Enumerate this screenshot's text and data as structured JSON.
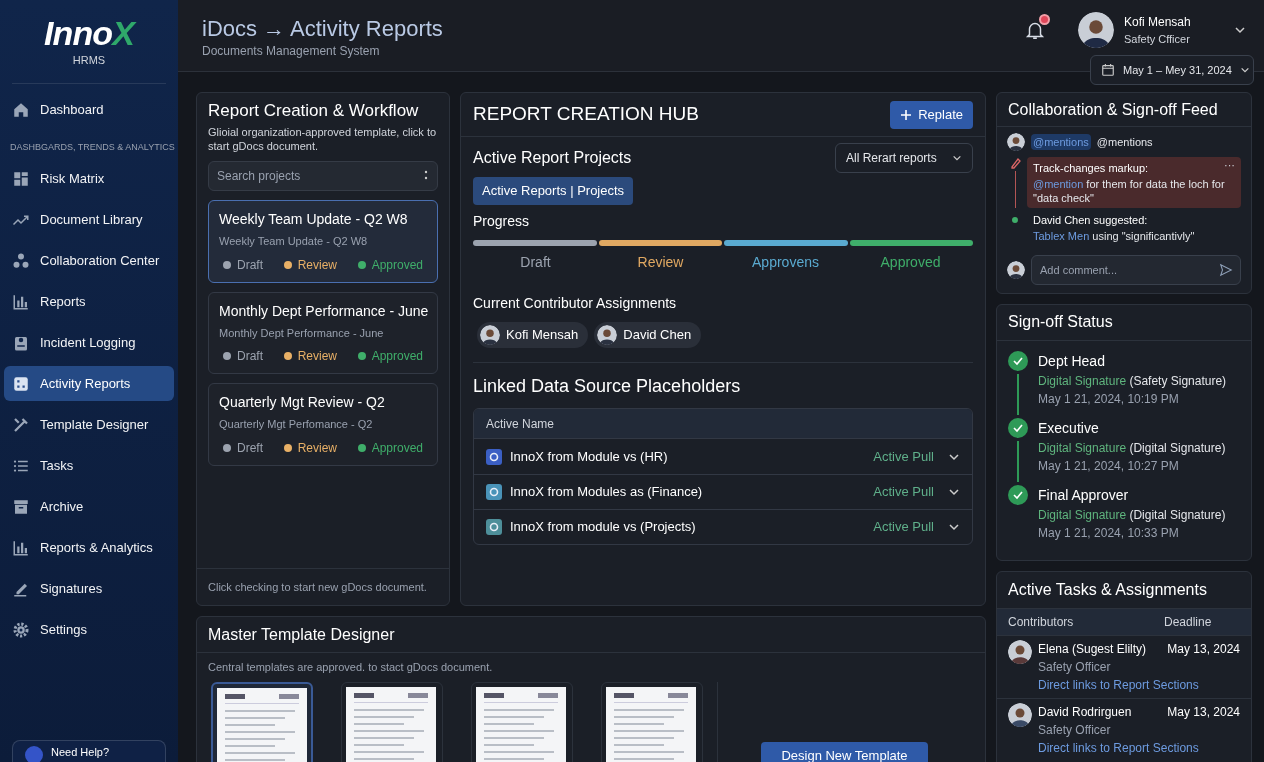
{
  "sidebar": {
    "logo": {
      "text": "Inno",
      "accent": "X",
      "subtitle": "HRMS"
    },
    "items": [
      {
        "kind": "item",
        "label": "Dashboard",
        "selected": false
      },
      {
        "kind": "section",
        "label": "DASHBGARDS, TRENDS & ANALYTICS"
      },
      {
        "kind": "item",
        "label": "Risk Matrix",
        "selected": false
      },
      {
        "kind": "item",
        "label": "Document Library",
        "selected": false
      },
      {
        "kind": "item",
        "label": "Collaboration Center",
        "selected": false
      },
      {
        "kind": "item",
        "label": "Reports",
        "selected": false
      },
      {
        "kind": "item",
        "label": "Incident Logging",
        "selected": false
      },
      {
        "kind": "item",
        "label": "Activity Reports",
        "selected": true
      },
      {
        "kind": "item",
        "label": "Template Designer",
        "selected": false
      },
      {
        "kind": "item",
        "label": "Tasks",
        "selected": false
      },
      {
        "kind": "item",
        "label": "Archive",
        "selected": false
      },
      {
        "kind": "item",
        "label": "Reports & Analytics",
        "selected": false
      },
      {
        "kind": "item",
        "label": "Signatures",
        "selected": false
      },
      {
        "kind": "item",
        "label": "Settings",
        "selected": false
      }
    ],
    "help": "Need Help?"
  },
  "header": {
    "title": "iDocs → Activity Reports",
    "subtitle": "Documents Management System",
    "notifications": true,
    "user": {
      "name": "Kofi Mensah",
      "role": "Safety Cfficer"
    },
    "date_range": "May 1 – Mey 31, 2024"
  },
  "workflow": {
    "title": "Report Creation & Workflow",
    "description": "Glioial organization-approved template, click to start gDocs document.",
    "search": {
      "placeholder": "Search projects"
    },
    "projects": [
      {
        "title": "Weekly Team Update - Q2 W8",
        "subtitle": "Weekly Team Update - Q2 W8",
        "selected": true,
        "statuses": [
          {
            "label": "Draft",
            "color": "#9ca3af"
          },
          {
            "label": "Review",
            "color": "#e8b066"
          },
          {
            "label": "Approved",
            "color": "#3fae6a"
          }
        ]
      },
      {
        "title": "Monthly Dept Performance - June",
        "subtitle": "Monthly Dept Performance - June",
        "selected": false,
        "statuses": [
          {
            "label": "Draft",
            "color": "#9ca3af"
          },
          {
            "label": "Review",
            "color": "#e8b066"
          },
          {
            "label": "Approved",
            "color": "#3fae6a"
          }
        ]
      },
      {
        "title": "Quarterly Mgt Review - Q2",
        "subtitle": "Quarterly Mgt Perfomance - Q2",
        "selected": false,
        "statuses": [
          {
            "label": "Dreft",
            "color": "#9ca3af"
          },
          {
            "label": "Review",
            "color": "#e8b066"
          },
          {
            "label": "Approved",
            "color": "#3fae6a"
          }
        ]
      }
    ],
    "footer": "Click checking to start new gDocs document."
  },
  "hub": {
    "title": "REPORT CREATION HUB",
    "button": "Replate",
    "section": "Active Report Projects",
    "filter": "All Rerart reports",
    "chip": "Active Reports | Projects",
    "progress_label": "Progress",
    "steps": [
      {
        "label": "Draft",
        "color": "#9ca3af"
      },
      {
        "label": "Review",
        "color": "#e0a862"
      },
      {
        "label": "Approvens",
        "color": "#5aaad0"
      },
      {
        "label": "Approved",
        "color": "#3fae6a"
      }
    ],
    "contributors_title": "Current Contributor Assignments",
    "contributors": [
      "Kofi Mensah",
      "David Chen"
    ],
    "sources_title": "Linked Data Source Placeholders",
    "sources_column": "Active Name",
    "sources": [
      {
        "name": "InnoX from Module vs (HR)",
        "status": "Active Pull",
        "color": "#3b5fc4"
      },
      {
        "name": "InnoX from Modules as (Finance)",
        "status": "Active Pull",
        "color": "#4a93b8"
      },
      {
        "name": "InnoX from module vs (Projects)",
        "status": "Active Pull",
        "color": "#4e8f9a"
      }
    ]
  },
  "feed": {
    "title": "Collaboration & Sign-off Feed",
    "mention_tag": "@mentions",
    "mention_text": "@mentions",
    "markup": {
      "title": "Track-changes markup:",
      "mention": "@mention",
      "text": "for them for data the loch for \"data check\"",
      "more": "···"
    },
    "suggestion": {
      "title": "David Chen suggested:",
      "link": "Tablex Men",
      "text": "using \"significantivly\""
    },
    "comment": {
      "placeholder": "Add comment..."
    }
  },
  "signoff": {
    "title": "Sign-off Status",
    "items": [
      {
        "role": "Dept Head",
        "signature": "Digital Signature",
        "type": "(Safety Signature)",
        "time": "May 1 21, 2024, 10:19 PM",
        "signed": true
      },
      {
        "role": "Executive",
        "signature": "Digital Signature",
        "type": "(Digital Signature)",
        "time": "May 1 21, 2024, 10:27 PM",
        "signed": true
      },
      {
        "role": "Final Approver",
        "signature": "Digital Signature",
        "type": "(Digital Signature)",
        "time": "May 1 21, 2024, 10:33 PM",
        "signed": true
      }
    ]
  },
  "tasks": {
    "title": "Active Tasks & Assignments",
    "columns": [
      "Contributors",
      "Deadline"
    ],
    "rows": [
      {
        "name": "Elena (Sugest Elilty)",
        "role": "Safety Officer",
        "link": "Direct links to Report Sections",
        "deadline": "May 13, 2024"
      },
      {
        "name": "David Rodrirguen",
        "role": "Safety Officer",
        "link": "Direct links to Report Sections",
        "deadline": "May 13, 2024"
      }
    ]
  },
  "templates": {
    "title": "Master Template Designer",
    "description": "Central templates are approved. to stact gDocs document.",
    "thumbnails": [
      {
        "selected": true
      },
      {
        "selected": false
      },
      {
        "selected": false
      },
      {
        "selected": false
      }
    ],
    "button": "Design New Template"
  }
}
